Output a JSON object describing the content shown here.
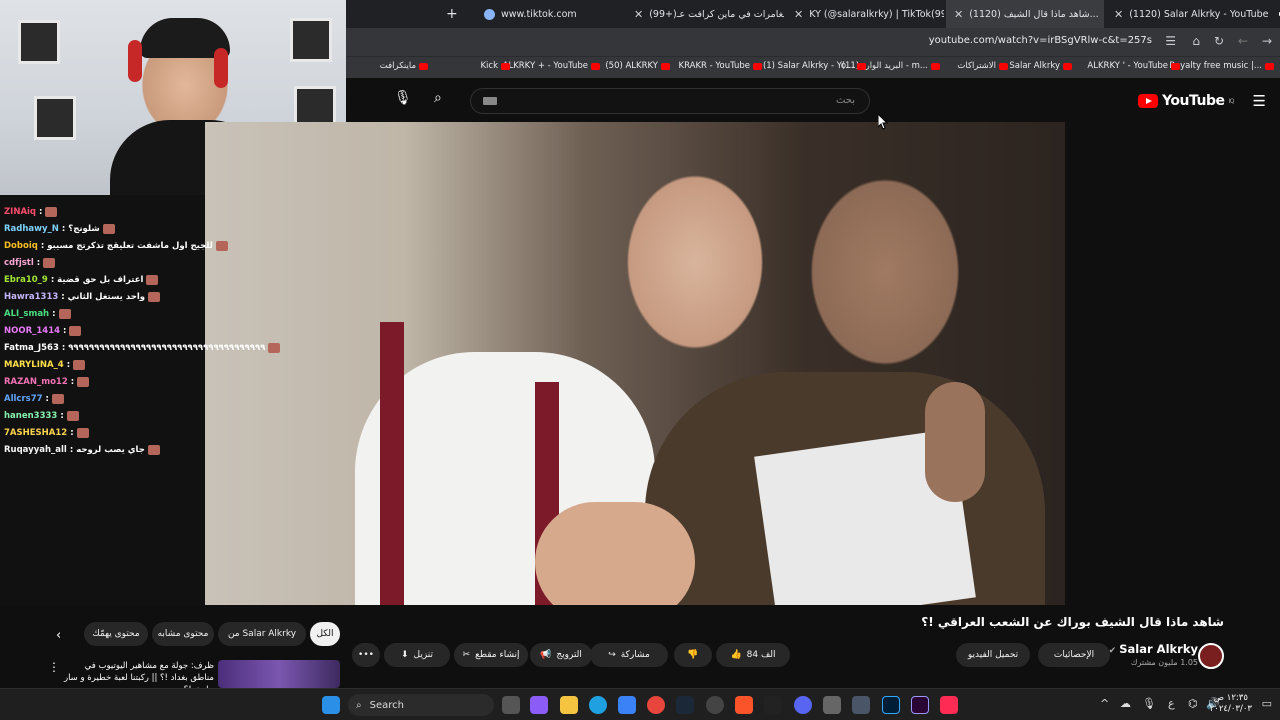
{
  "browser": {
    "tabs": [
      {
        "label": "(1120) Salar Alkrky - YouTube",
        "icon": "youtube"
      },
      {
        "label": "(1120) شاهد ماذا قال الشيف...",
        "icon": "youtube",
        "active": true
      },
      {
        "label": "KY (@salaralkrky) | TikTok(99+)",
        "icon": "tiktok"
      },
      {
        "label": "(99+)مغامرات في ماين كرافت عـ",
        "icon": "tiktok"
      },
      {
        "label": "www.tiktok.com",
        "icon": "globe"
      }
    ],
    "url": "youtube.com/watch?v=irBSgVRlw-c&t=257s",
    "bookmarks": [
      "Royalty free music |...",
      "ALKRKY ' - YouTube",
      "Salar Alkrky",
      "الاشتراكات",
      "البريد الوارد (11) - m...",
      "(1) Salar Alkrky - Yo...",
      "KRAKR - YouTube",
      "(50) ALKRKY",
      "ALKRKY + - YouTube",
      "Kick",
      "ماينكرافت"
    ]
  },
  "youtube": {
    "logo_text": "YouTube",
    "logo_region": "IQ",
    "search_placeholder": "بحث",
    "video_title": "شاهد ماذا قال الشيف بوراك عن الشعب العراقي !؟",
    "channel_name": "Salar Alkrky",
    "subscribers": "1.05 مليون مشترك",
    "buttons": {
      "stats": "الإحصائيات",
      "edit_video": "تحميل الفيديو",
      "likes": "84 الف",
      "share": "مشاركة",
      "promote": "الترويج",
      "clip": "إنشاء مقطع",
      "download": "تنزيل"
    },
    "chips": [
      "الكل",
      "من Salar Alkrky",
      "محتوى مشابه",
      "محتوى يهمّك"
    ],
    "recommended": {
      "title": "ظرف: جولة مع مشاهير اليوتيوب في مناطق بغداد !؟ || ركبتنا لعبة خطيرة و سار حادث !؟"
    }
  },
  "chat": {
    "messages": [
      {
        "user": "ZINAiq",
        "text": ":",
        "color": "#ff4d6d"
      },
      {
        "user": "Radhawy_N",
        "text": ": شلونج؟",
        "color": "#7dd3fc"
      },
      {
        "user": "Doboiq",
        "text": ": للجيج اول ماشفت تعليقج تذكرتج مسيبو",
        "color": "#fbbf24"
      },
      {
        "user": "cdfjstl",
        "text": ":",
        "color": "#f9a8d4"
      },
      {
        "user": "Ebra10_9",
        "text": ": اعتراف بل حق قضية",
        "color": "#a3e635"
      },
      {
        "user": "Hawra1313",
        "text": ": واحد يستغل الثاني",
        "color": "#c4b5fd"
      },
      {
        "user": "ALI_smah",
        "text": ":",
        "color": "#4ade80"
      },
      {
        "user": "NOOR_1414",
        "text": ":",
        "color": "#e879f9"
      },
      {
        "user": "Fatma_J563",
        "text": ": ٩٩٩٩٩٩٩٩٩٩٩٩٩٩٩٩٩٩٩٩٩٩٩٩٩٩٩٩٩٩٩٩٩٩٩٩٩٩",
        "color": "#ffffff"
      },
      {
        "user": "MARYLINA_4",
        "text": ":",
        "color": "#fde047"
      },
      {
        "user": "RAZAN_mo12",
        "text": ":",
        "color": "#f472b6"
      },
      {
        "user": "Allcrs77",
        "text": ":",
        "color": "#60a5fa"
      },
      {
        "user": "hanen3333",
        "text": ":",
        "color": "#86efac"
      },
      {
        "user": "7ASHESHA12",
        "text": ":",
        "color": "#fcd34d"
      },
      {
        "user": "Ruqayyah_all",
        "text": ": جاي يصب لروحه",
        "color": "#f5f5f5"
      }
    ]
  },
  "taskbar": {
    "search_label": "Search",
    "time": "١٢:٣٥ ص",
    "date": "٢٠٢٤/٠٣/٠٣",
    "input_lang": "ع"
  },
  "colors": {
    "youtube_red": "#ff0000",
    "page_bg": "#0f0f0f",
    "chip_bg": "#272727"
  }
}
